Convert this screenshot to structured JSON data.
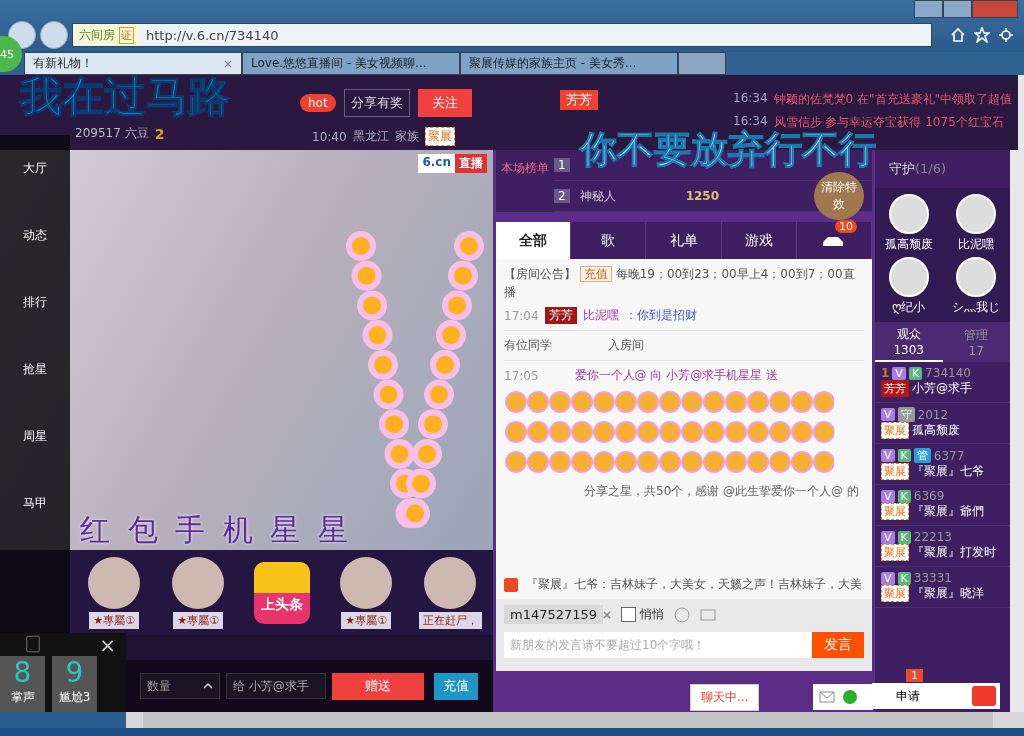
{
  "browser": {
    "badge": "45",
    "site_label": "六间房",
    "cert": "证",
    "url": "http://v.6.cn/734140",
    "tabs": [
      {
        "title": "有新礼物！",
        "selected": true,
        "close": "×"
      },
      {
        "title": "Love.悠悠直播间 - 美女视频聊...",
        "selected": false
      },
      {
        "title": "聚展传媒的家族主页 - 美女秀...",
        "selected": false
      }
    ]
  },
  "overlays": {
    "top_left": "我在过马路",
    "top_right": "你不要放弃行不行",
    "video_caption": "红 包 手 机 星 星"
  },
  "header": {
    "beans": "209517 六豆",
    "level": "2",
    "hot": "hot",
    "share": "分享有奖",
    "follow": "关注",
    "time": "10:40",
    "location": "黑龙江",
    "family_label": "家族",
    "family": "聚展",
    "flag": "芳芳"
  },
  "notices": [
    {
      "time": "16:34",
      "text": "钟颖的佐梵梵0 在\"首充送豪礼\"中领取了超值"
    },
    {
      "time": "16:34",
      "text": "风雪信步 参与幸运夺宝获得 1075个红宝石"
    }
  ],
  "sidebar": [
    "大厅",
    "动态",
    "排行",
    "抢星",
    "周星",
    "马甲"
  ],
  "video": {
    "logo": "6.cn",
    "live": "直播"
  },
  "showcase": [
    {
      "kind": "avatar",
      "label": "★專屬①"
    },
    {
      "kind": "avatar",
      "label": "★專屬①"
    },
    {
      "kind": "headline",
      "label": "上头条"
    },
    {
      "kind": "avatar",
      "label": "★專屬①"
    },
    {
      "kind": "avatar",
      "label": "正在赶尸，"
    }
  ],
  "popup": {
    "close": "×",
    "cards": [
      {
        "number": "8",
        "label": "掌声"
      },
      {
        "number": "9",
        "label": "尴尬3"
      }
    ]
  },
  "gift_bar": {
    "quantity": "数量",
    "to": "给",
    "recipient": "小芳@求手",
    "send": "赠送",
    "recharge": "充值"
  },
  "ranking": {
    "label": "本场榜单",
    "rows": [
      {
        "rank": "1"
      },
      {
        "rank": "2",
        "name": "神秘人",
        "amount": "1250"
      }
    ],
    "clear": "清除特效"
  },
  "chat_tabs": [
    {
      "label": "全部",
      "selected": true
    },
    {
      "label": "歌",
      "selected": false
    },
    {
      "label": "礼单",
      "selected": false
    },
    {
      "label": "游戏",
      "selected": false
    },
    {
      "selected": false,
      "badge": "10"
    }
  ],
  "announcement": {
    "title": "【房间公告】",
    "recharge": "充值",
    "text": "每晚19；00到23；00早上4；00到7；00直播"
  },
  "messages": [
    {
      "kind": "chat",
      "time": "17:04",
      "tag": "芳芳",
      "name": "比泥嘿",
      "text": "：你到是招财"
    },
    {
      "kind": "system",
      "parts": [
        "有位同学",
        "入房间"
      ]
    },
    {
      "kind": "gift",
      "time": "17:05",
      "text": "爱你一个人@ 向 小芳@求手机星星 送",
      "thanks": "分享之星，共50个，感谢 @此生挚爱你一个人@ 的"
    }
  ],
  "broadcast": "『聚展』七爷：吉林妹子，大美女，天籁之声！吉林妹子，大美",
  "composer": {
    "user": "m147527159",
    "whisper": {
      "label": "悄悄",
      "checked": false
    },
    "placeholder": "新朋友的发言请不要超过10个字哦！",
    "send": "发言",
    "status": "聊天中..."
  },
  "guards": {
    "title": "守护",
    "count": "(1/6)",
    "members": [
      "孤高颓废",
      "比泥嘿",
      "ღ纪小",
      "シ灬我じ"
    ]
  },
  "audience_tabs": [
    {
      "label": "观众",
      "count": "1303",
      "selected": true
    },
    {
      "label": "管理",
      "count": "17",
      "selected": false
    }
  ],
  "users": [
    {
      "rank": "1",
      "badges": [
        "V",
        "K"
      ],
      "id": "734140",
      "tag": "芳芳",
      "name": "小芳@求手"
    },
    {
      "badges": [
        "V",
        "守"
      ],
      "id": "2012",
      "tag": "聚展",
      "name": "孤高颓废"
    },
    {
      "badges": [
        "V",
        "K",
        "管"
      ],
      "id": "6377",
      "tag": "聚展",
      "name": "『聚展』七爷"
    },
    {
      "badges": [
        "V",
        "K"
      ],
      "id": "6369",
      "tag": "聚展",
      "name": "『聚展』爺們"
    },
    {
      "badges": [
        "V",
        "K"
      ],
      "id": "22213",
      "tag": "聚展",
      "name": "『聚展』打发时"
    },
    {
      "badges": [
        "V",
        "K"
      ],
      "id": "33331",
      "tag": "聚展",
      "name": "『聚展』晓洋"
    }
  ],
  "apply": {
    "label": "申请",
    "badge": "1"
  }
}
